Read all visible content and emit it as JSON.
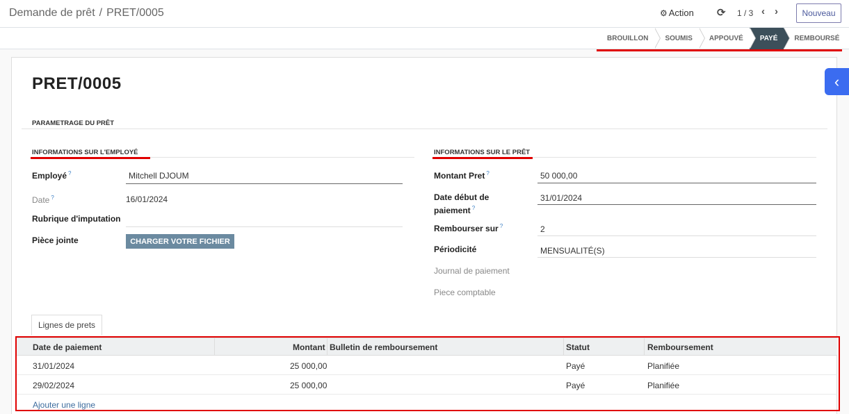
{
  "breadcrumb": {
    "parent": "Demande de prêt",
    "separator": "/",
    "current": "PRET/0005"
  },
  "control": {
    "action_label": "Action",
    "pager_value": "1 / 3",
    "new_label": "Nouveau"
  },
  "status": {
    "stages": [
      "BROUILLON",
      "SOUMIS",
      "APPOUVÉ",
      "PAYÉ",
      "REMBOURSÉ"
    ],
    "active_index": 3
  },
  "record": {
    "title": "PRET/0005"
  },
  "sections": {
    "main": "PARAMETRAGE DU PRÊT",
    "employee": "INFORMATIONS SUR L'EMPLOYÉ",
    "loan": "INFORMATIONS SUR LE PRÊT"
  },
  "employee_fields": {
    "employe_label": "Employé",
    "employe_value": "Mitchell DJOUM",
    "date_label": "Date",
    "date_value": "16/01/2024",
    "rubrique_label": "Rubrique d'imputation",
    "piece_label": "Pièce jointe",
    "upload_label": "CHARGER VOTRE FICHIER"
  },
  "loan_fields": {
    "montant_label": "Montant Pret",
    "montant_value": "50 000,00",
    "date_debut_label_1": "Date début de",
    "date_debut_label_2": "paiement",
    "date_debut_value": "31/01/2024",
    "rembourser_label": "Rembourser sur",
    "rembourser_value": "2",
    "periodicite_label": "Périodicité",
    "periodicite_value": "MENSUALITÉ(S)",
    "journal_label": "Journal de paiement",
    "piece_comptable_label": "Piece comptable"
  },
  "help_mark": "?",
  "tab": {
    "label": "Lignes de prets"
  },
  "table": {
    "headers": [
      "Date de paiement",
      "Montant",
      "Bulletin de remboursement",
      "Statut",
      "Remboursement"
    ],
    "rows": [
      [
        "31/01/2024",
        "25 000,00",
        "",
        "Payé",
        "Planifiée"
      ],
      [
        "29/02/2024",
        "25 000,00",
        "",
        "Payé",
        "Planifiée"
      ]
    ],
    "add_line": "Ajouter une ligne"
  },
  "colors": {
    "accent": "#e00000",
    "active_stage": "#3c4f5a",
    "side_button": "#3b6cf0",
    "upload_button": "#6b8aa0"
  },
  "icons": {
    "action": "gear-icon",
    "reload": "refresh-icon",
    "prev": "chevron-left-icon",
    "next": "chevron-right-icon",
    "side": "chevron-left-icon"
  }
}
